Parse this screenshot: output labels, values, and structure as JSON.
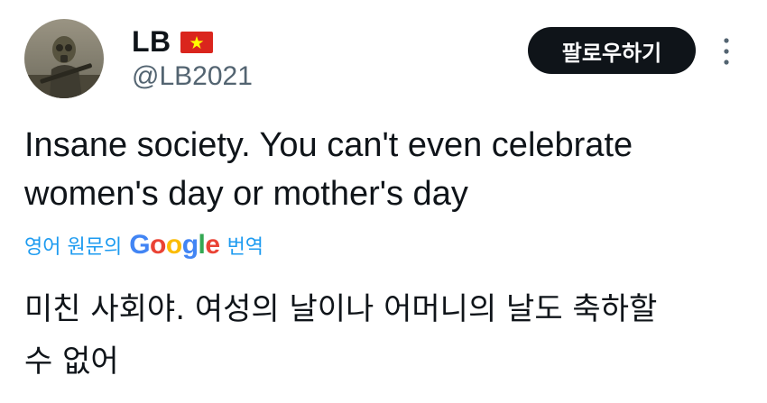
{
  "author": {
    "display_name": "LB",
    "flag_icon": "vietnam-flag-icon",
    "handle": "@LB2021"
  },
  "actions": {
    "follow_label": "팔로우하기",
    "more_icon": "more-vertical-icon"
  },
  "tweet": {
    "line1": "Insane society. You can't even celebrate",
    "line2": "women's day or mother's day"
  },
  "translation": {
    "prefix": "영어 원문의",
    "brand": "Google",
    "suffix": "번역",
    "line1": "미친 사회야. 여성의 날이나 어머니의 날도 축하할",
    "line2": "수 없어"
  },
  "colors": {
    "link_blue": "#1d9bf0",
    "button_bg": "#0f1419",
    "handle_gray": "#536471",
    "flag_red": "#da251d",
    "flag_star": "#ffff00",
    "google_blue": "#4285f4",
    "google_red": "#ea4335",
    "google_yellow": "#fbbc05",
    "google_green": "#34a853"
  }
}
